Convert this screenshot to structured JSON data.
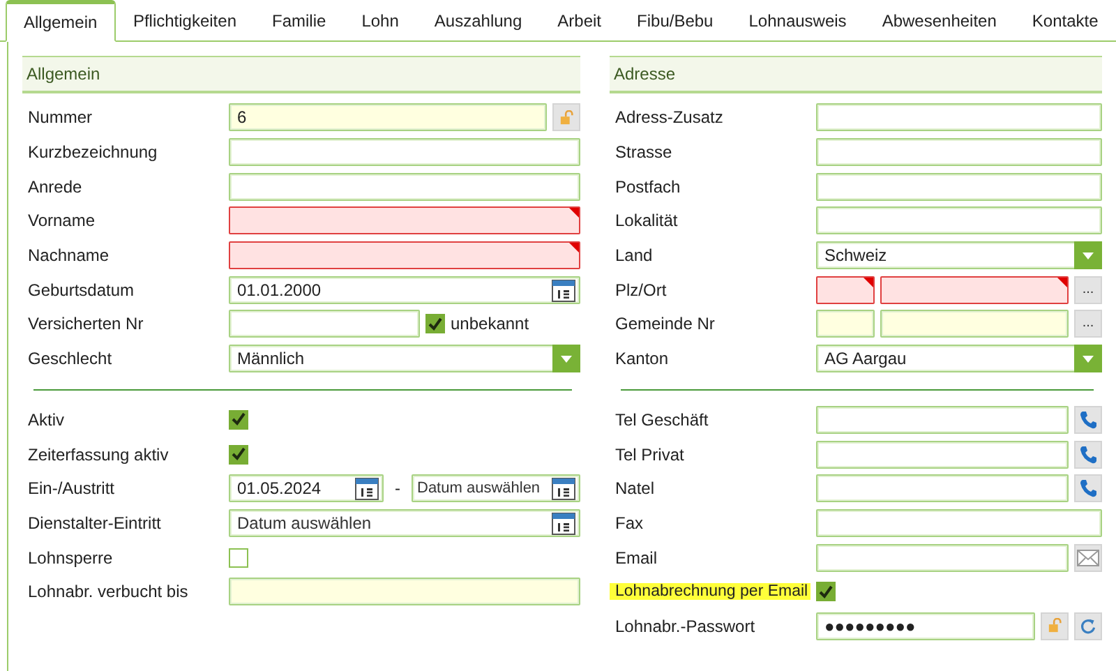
{
  "tabs": [
    {
      "label": "Allgemein",
      "selected": true
    },
    {
      "label": "Pflichtigkeiten",
      "selected": false
    },
    {
      "label": "Familie",
      "selected": false
    },
    {
      "label": "Lohn",
      "selected": false
    },
    {
      "label": "Auszahlung",
      "selected": false
    },
    {
      "label": "Arbeit",
      "selected": false
    },
    {
      "label": "Fibu/Bebu",
      "selected": false
    },
    {
      "label": "Lohnausweis",
      "selected": false
    },
    {
      "label": "Abwesenheiten",
      "selected": false
    },
    {
      "label": "Kontakte",
      "selected": false
    }
  ],
  "left": {
    "title": "Allgemein",
    "rows": [
      {
        "kind": "text",
        "label": "Nummer",
        "value": "6",
        "readonly": true,
        "buttons": [
          {
            "kind": "lock"
          }
        ]
      },
      {
        "kind": "text",
        "label": "Kurzbezeichnung"
      },
      {
        "kind": "text",
        "label": "Anrede"
      },
      {
        "kind": "text",
        "label": "Vorname",
        "invalid": true
      },
      {
        "kind": "text",
        "label": "Nachname",
        "invalid": true
      },
      {
        "kind": "date",
        "label": "Geburtsdatum",
        "value": "01.01.2000"
      },
      {
        "kind": "text_check",
        "label": "Versicherten Nr",
        "checked": true,
        "check_label": "unbekannt"
      },
      {
        "kind": "select",
        "label": "Geschlecht",
        "value": "Männlich"
      },
      {
        "kind": "divider"
      },
      {
        "kind": "check",
        "label": "Aktiv",
        "checked": true
      },
      {
        "kind": "check",
        "label": "Zeiterfassung aktiv",
        "checked": true
      },
      {
        "kind": "daterange",
        "label": "Ein-/Austritt",
        "value": "01.05.2024",
        "separator": "-",
        "placeholder": "Datum auswählen"
      },
      {
        "kind": "date",
        "label": "Dienstalter-Eintritt",
        "placeholder": "Datum auswählen"
      },
      {
        "kind": "check",
        "label": "Lohnsperre",
        "checked": false
      },
      {
        "kind": "text",
        "label": "Lohnabr. verbucht bis",
        "readonly": true
      }
    ]
  },
  "right": {
    "title": "Adresse",
    "rows": [
      {
        "kind": "text",
        "label": "Adress-Zusatz"
      },
      {
        "kind": "text",
        "label": "Strasse"
      },
      {
        "kind": "text",
        "label": "Postfach"
      },
      {
        "kind": "text",
        "label": "Lokalität"
      },
      {
        "kind": "select",
        "label": "Land",
        "value": "Schweiz"
      },
      {
        "kind": "pair",
        "label": "Plz/Ort",
        "invalid": true,
        "buttons": [
          {
            "kind": "more",
            "label": "..."
          }
        ]
      },
      {
        "kind": "pair",
        "label": "Gemeinde Nr",
        "readonly": true,
        "buttons": [
          {
            "kind": "more",
            "label": "..."
          }
        ]
      },
      {
        "kind": "select",
        "label": "Kanton",
        "value": "AG Aargau"
      },
      {
        "kind": "divider"
      },
      {
        "kind": "text",
        "label": "Tel Geschäft",
        "buttons": [
          {
            "kind": "phone"
          }
        ]
      },
      {
        "kind": "text",
        "label": "Tel Privat",
        "buttons": [
          {
            "kind": "phone"
          }
        ]
      },
      {
        "kind": "text",
        "label": "Natel",
        "buttons": [
          {
            "kind": "phone"
          }
        ]
      },
      {
        "kind": "text",
        "label": "Fax"
      },
      {
        "kind": "text",
        "label": "Email",
        "buttons": [
          {
            "kind": "mail"
          }
        ]
      },
      {
        "kind": "check",
        "label": "Lohnabrechnung per Email",
        "checked": true,
        "highlight": true
      },
      {
        "kind": "text",
        "label": "Lohnabr.-Passwort",
        "value": "●●●●●●●●●",
        "buttons": [
          {
            "kind": "lock"
          },
          {
            "kind": "refresh"
          }
        ]
      }
    ]
  }
}
